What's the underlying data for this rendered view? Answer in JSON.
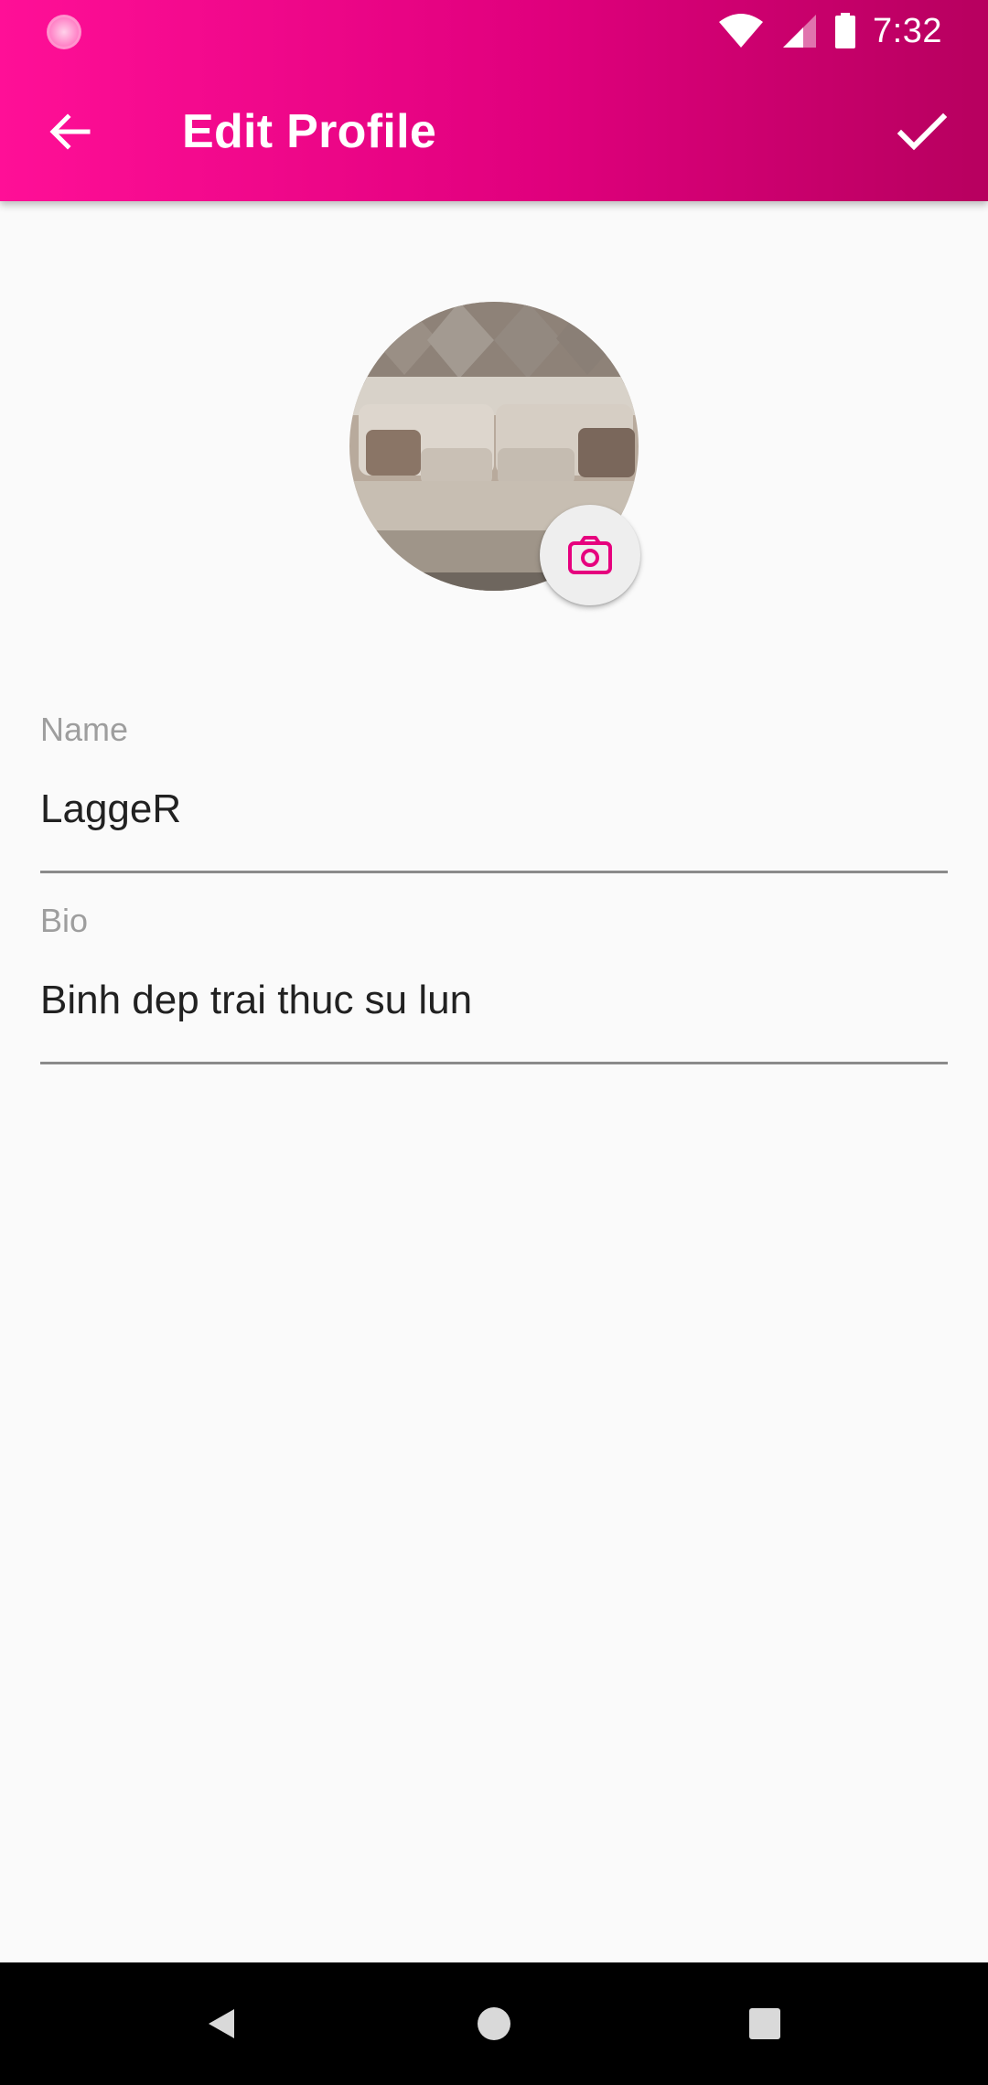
{
  "status_bar": {
    "time": "7:32",
    "icons": [
      "notification-dot-icon",
      "wifi-icon",
      "cell-signal-icon",
      "battery-icon"
    ]
  },
  "app_bar": {
    "title": "Edit Profile",
    "back_icon": "arrow-back-icon",
    "confirm_icon": "check-icon"
  },
  "profile": {
    "avatar_icon": "photo-avatar",
    "change_photo_icon": "camera-icon"
  },
  "form": {
    "name": {
      "label": "Name",
      "value": "LaggeR"
    },
    "bio": {
      "label": "Bio",
      "value": "Binh dep trai thuc su lun"
    }
  },
  "nav_bar": {
    "buttons": [
      "back-triangle-icon",
      "home-circle-icon",
      "recents-square-icon"
    ]
  },
  "colors": {
    "primary": "#e6007e",
    "primary_dark": "#b7005f",
    "background": "#fafafa"
  }
}
